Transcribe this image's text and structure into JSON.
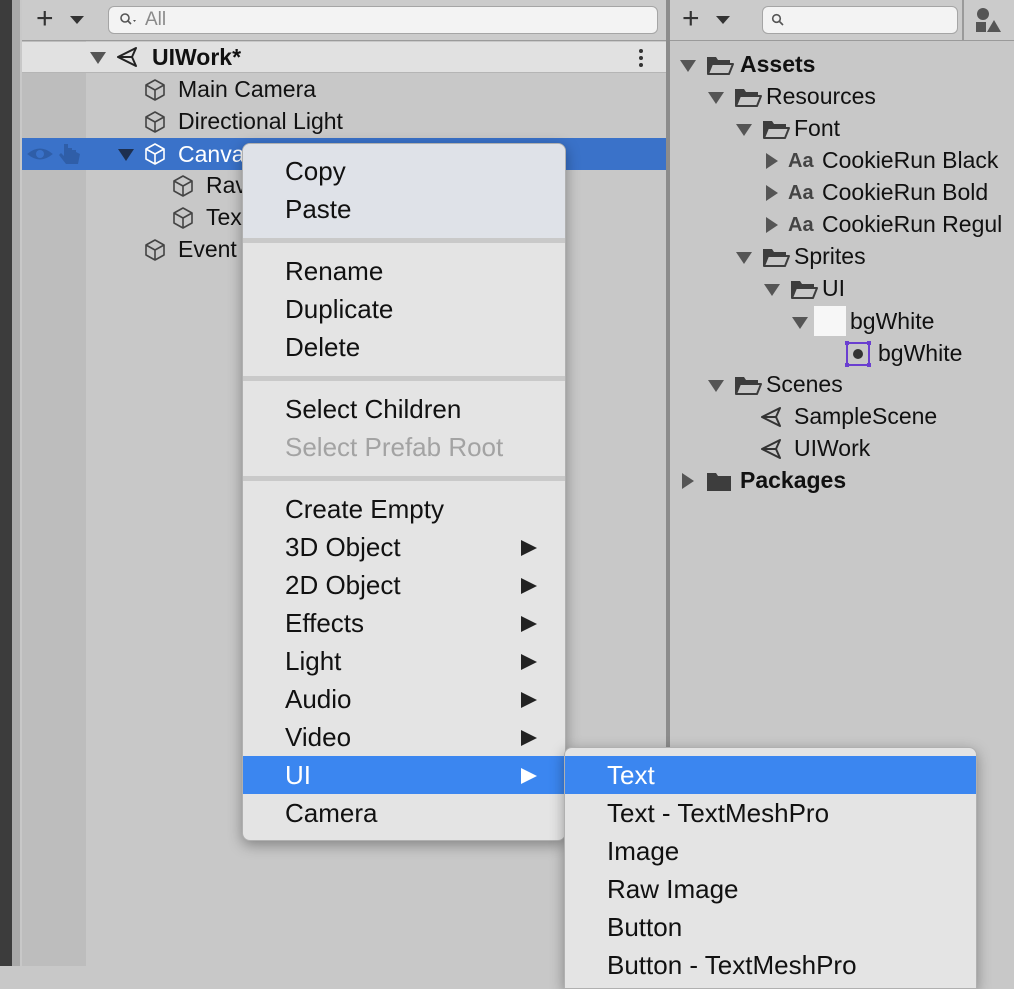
{
  "hierarchy": {
    "search_placeholder": "All",
    "scene_name": "UIWork*",
    "items": [
      {
        "label": "Main Camera"
      },
      {
        "label": "Directional Light"
      },
      {
        "label": "Canva"
      },
      {
        "label": "Rav"
      },
      {
        "label": "Tex"
      },
      {
        "label": "Event"
      }
    ]
  },
  "project": {
    "tree": [
      {
        "label": "Assets"
      },
      {
        "label": "Resources"
      },
      {
        "label": "Font"
      },
      {
        "label": "CookieRun Black"
      },
      {
        "label": "CookieRun Bold"
      },
      {
        "label": "CookieRun Regul"
      },
      {
        "label": "Sprites"
      },
      {
        "label": "UI"
      },
      {
        "label": "bgWhite"
      },
      {
        "label": "bgWhite"
      },
      {
        "label": "Scenes"
      },
      {
        "label": "SampleScene"
      },
      {
        "label": "UIWork"
      },
      {
        "label": "Packages"
      }
    ],
    "font_icon_text": "Aa"
  },
  "context_menu": {
    "items": [
      {
        "label": "Copy"
      },
      {
        "label": "Paste"
      },
      {
        "label": "Rename"
      },
      {
        "label": "Duplicate"
      },
      {
        "label": "Delete"
      },
      {
        "label": "Select Children"
      },
      {
        "label": "Select Prefab Root"
      },
      {
        "label": "Create Empty"
      },
      {
        "label": "3D Object"
      },
      {
        "label": "2D Object"
      },
      {
        "label": "Effects"
      },
      {
        "label": "Light"
      },
      {
        "label": "Audio"
      },
      {
        "label": "Video"
      },
      {
        "label": "UI"
      },
      {
        "label": "Camera"
      }
    ]
  },
  "submenu": {
    "items": [
      {
        "label": "Text"
      },
      {
        "label": "Text - TextMeshPro"
      },
      {
        "label": "Image"
      },
      {
        "label": "Raw Image"
      },
      {
        "label": "Button"
      },
      {
        "label": "Button - TextMeshPro"
      }
    ]
  },
  "colors": {
    "selection": "#3a72c9",
    "menu_highlight": "#3b86f0",
    "panel_bg": "#c8c8c8"
  }
}
